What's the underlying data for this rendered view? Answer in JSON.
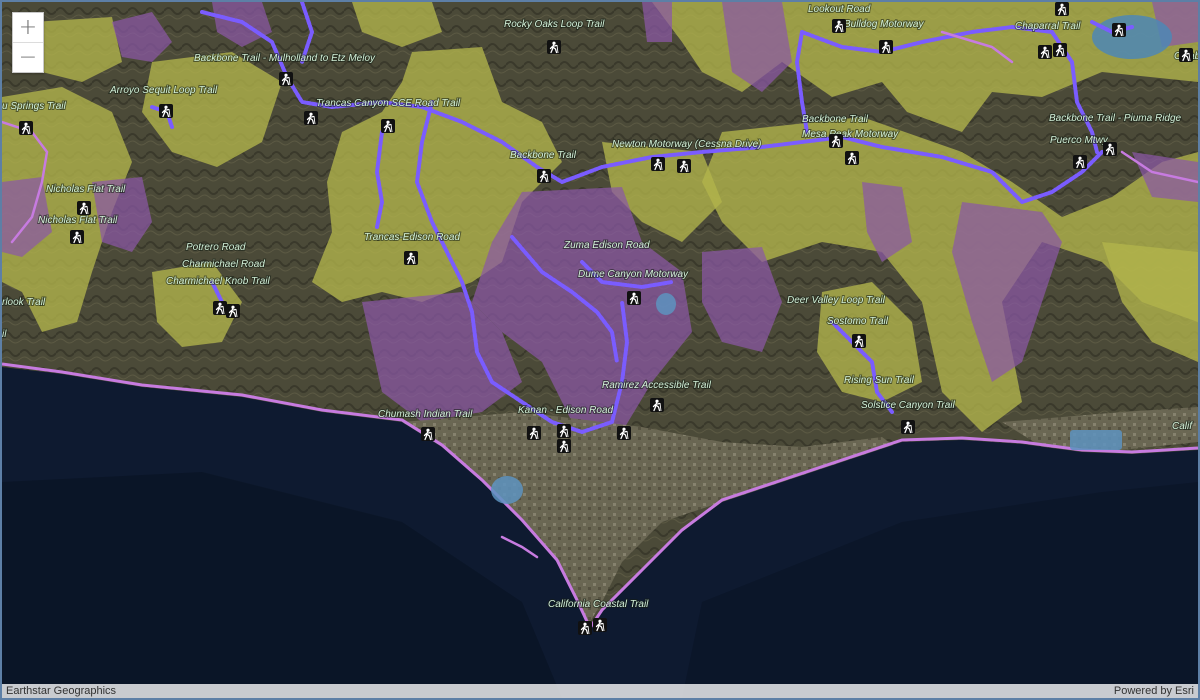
{
  "map": {
    "zoom_in_label": "+",
    "zoom_out_label": "−",
    "attribution_left": "Earthstar Geographics",
    "attribution_right": "Powered by Esri",
    "colors": {
      "ocean": "#0e1a2e",
      "land": "#4a4a36",
      "green_zone": "#b5b84e",
      "purple_zone": "#8d5aa6",
      "trail": "#7b5cff",
      "coast": "#c47ad6",
      "lake": "#5a8fb8"
    }
  },
  "trail_labels": [
    {
      "id": "backbone-mulholland",
      "text": "Backbone Trail - Mulholland to Etz Meloy"
    },
    {
      "id": "rocky-oaks",
      "text": "Rocky Oaks Loop Trail"
    },
    {
      "id": "lookout-road",
      "text": "Lookout Road"
    },
    {
      "id": "bulldog",
      "text": "Bulldog Motorway"
    },
    {
      "id": "chaparral",
      "text": "Chaparral Trail"
    },
    {
      "id": "calab",
      "text": "Calab"
    },
    {
      "id": "arroyo-sequit",
      "text": "Arroyo Sequit Loop Trail"
    },
    {
      "id": "springs",
      "text": "u Springs Trail"
    },
    {
      "id": "trancas-sce",
      "text": "Trancas Canyon SCE Road Trail"
    },
    {
      "id": "backbone-trail-1",
      "text": "Backbone Trail"
    },
    {
      "id": "backbone-piuma",
      "text": "Backbone Trail - Piuma Ridge"
    },
    {
      "id": "mesa-peak",
      "text": "Mesa Peak Motorway"
    },
    {
      "id": "puerco",
      "text": "Puerco Mtwy"
    },
    {
      "id": "newton",
      "text": "Newton Motorway (Cessna Drive)"
    },
    {
      "id": "backbone-trail-2",
      "text": "Backbone Trail"
    },
    {
      "id": "nicholas-1",
      "text": "Nicholas Flat Trail"
    },
    {
      "id": "nicholas-2",
      "text": "Nicholas Flat Trail"
    },
    {
      "id": "trancas-edison",
      "text": "Trancas-Edison Road"
    },
    {
      "id": "zuma-edison",
      "text": "Zuma Edison Road"
    },
    {
      "id": "potrero",
      "text": "Potrero Road"
    },
    {
      "id": "charmichael-road",
      "text": "Charmichael Road"
    },
    {
      "id": "charmichael-knob",
      "text": "Charmichael Knob Trail"
    },
    {
      "id": "dume-canyon",
      "text": "Dume Canyon Motorway"
    },
    {
      "id": "deer-valley",
      "text": "Deer Valley Loop Trail"
    },
    {
      "id": "rlook",
      "text": "rlook Trail"
    },
    {
      "id": "sostomo",
      "text": "Sostomo Trail"
    },
    {
      "id": "rising-sun",
      "text": "Rising Sun Trail"
    },
    {
      "id": "ramirez",
      "text": "Ramirez Accessible Trail"
    },
    {
      "id": "solstice",
      "text": "Solstice Canyon Trail"
    },
    {
      "id": "chumash",
      "text": "Chumash Indian Trail"
    },
    {
      "id": "kanan-edison",
      "text": "Kanan - Edison Road"
    },
    {
      "id": "calif-right",
      "text": "Calif"
    },
    {
      "id": "california-coastal",
      "text": "California Coastal Trail"
    },
    {
      "id": "il",
      "text": "il"
    }
  ]
}
